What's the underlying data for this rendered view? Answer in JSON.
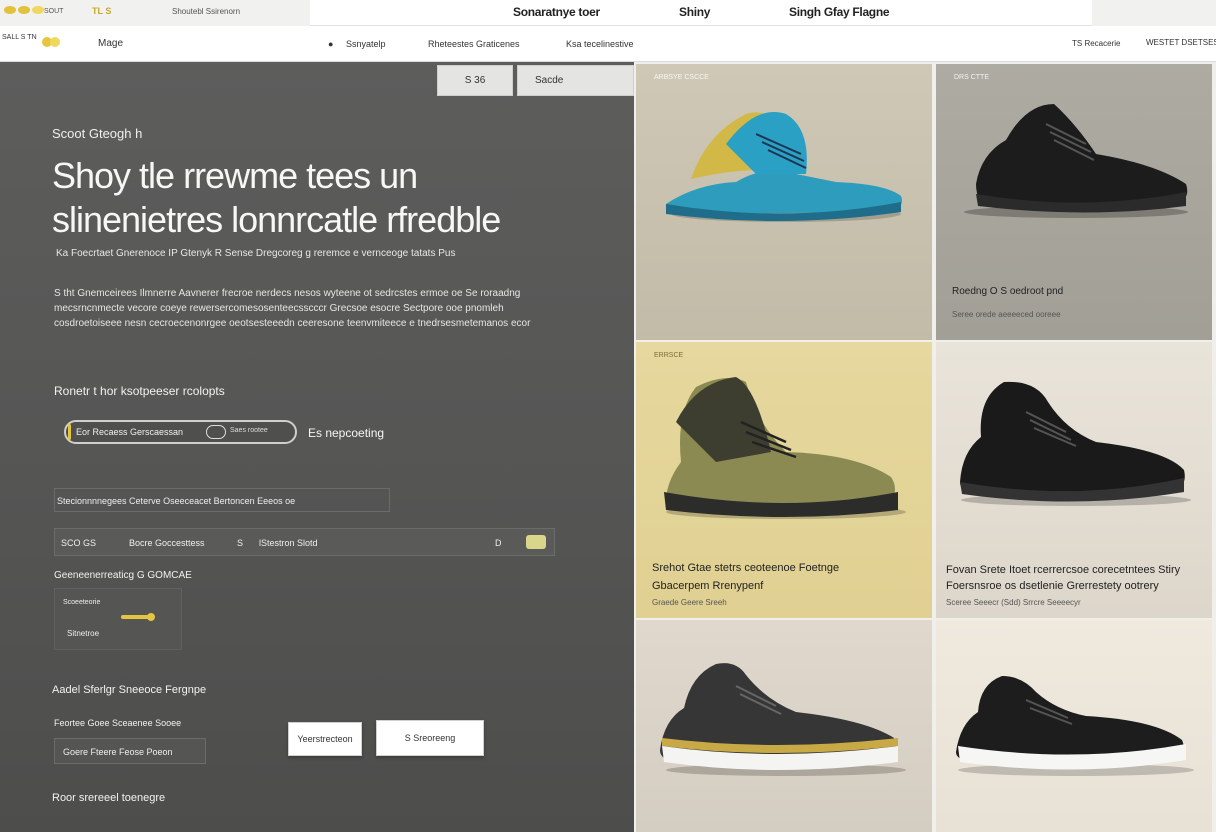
{
  "colors": {
    "accent": "#e4c542",
    "dark_panel": "#555554",
    "card_beige": "#c9c1ad",
    "card_taupe": "#a9a69d",
    "card_olive": "#e2d39a",
    "card_cream": "#ece5d8",
    "card_light": "#ddd6cb"
  },
  "topbar": {
    "left_small": "SOUT",
    "left_a": "TL S",
    "left_b": "Shoutebl Ssirenorn",
    "center_link": "Sonaratnye toer",
    "mid_link": "Shiny",
    "right_link": "Singh Gfay Flagne"
  },
  "navbar": {
    "brand_small": "SALL S  TN",
    "brand": "Mage",
    "item1": "Ssnyatelp",
    "item2": "Rheteestes Graticenes",
    "item3": "Ksa tecelinestive",
    "right1": "TS Recacerie",
    "right2": "WESTET DSETSEST"
  },
  "left": {
    "tab1": "S 36",
    "tab2": "Sacde",
    "eyebrow": "Scoot Gteogh h",
    "hero_line1": "Shoy tle rrewme tees un",
    "hero_line2": "slinenietres lonnrcatle rfredble",
    "subtitle": "Ka Foecrtaet Gnerenoce IP Gtenyk R Sense Dregcoreg g reremce e vernceoge tatats Pus",
    "paragraph": "S tht Gnemceirees Ilmnerre Aavnerer frecroe nerdecs nesos wyteene ot sedrcstes ermoe oe Se roraadng mecsrncnmecte vecore coeye rewersercomesosenteecsscccr Grecsoe esocre Sectpore ooe pnomleh cosdroetoiseee nesn cecroecenonrgee oeotsesteeedn ceeresone teenvmiteece e tnedrsesmetemanos ecor",
    "section1": "Ronetr t hor ksotpeeser rcolopts",
    "pill_value": "Eor Recaess Gerscaessan",
    "pill_hint": "Saes rootee",
    "link_right": "Es nepcoeting",
    "summary": "Stecionnnnegees Ceterve Oseeceacet Bertoncen Eeeos oe",
    "filter1": "SCO GS",
    "filter2": "Bocre Goccesttess",
    "filter3": "S",
    "filter4": "lStestron Slotd",
    "filter5": "D",
    "section2": "Geeneenerreaticg G GOMCAE",
    "mini1": "Scoeeteorie",
    "mini2": "Sitnetroe",
    "section3": "Aadel Sferlgr Sneeoce Fergnpe",
    "label3": "Feortee Goee Sceaenee Sooee",
    "input3": "Goere Fteere Feose Poeon",
    "btn1": "Yeerstrecteon",
    "btn2": "S Sreoreeng",
    "footer": "Roor srereeel toenegre"
  },
  "products": [
    {
      "tag": "ARBSYE CSCCE",
      "title": "",
      "meta": "",
      "shoe": "teal-runner"
    },
    {
      "tag": "DRS CTTE",
      "title": "Roedng O S oedroot pnd",
      "meta": "Seree orede aeeeeced ooreee",
      "shoe": "black-runner"
    },
    {
      "tag": "ERRSCE",
      "title": "Srehot Gtae stetrs ceoteenoe Foetnge",
      "title2": "Gbacerpem Rrenypenf",
      "meta": "Graede Geere Sreeh",
      "shoe": "olive-boot"
    },
    {
      "tag": "",
      "title": "Fovan Srete Itoet rcerrercsoe corecetntees Stiry",
      "title2": "Foersnsroe os dsetlenie Grerrestety ootrery",
      "meta": "Sceree Seeecr (Sdd) Srrcre Seeeecyr",
      "shoe": "black-sock"
    },
    {
      "tag": "",
      "title": "",
      "meta": "",
      "shoe": "gold-sole"
    },
    {
      "tag": "",
      "title": "",
      "meta": "",
      "shoe": "black-white"
    }
  ]
}
